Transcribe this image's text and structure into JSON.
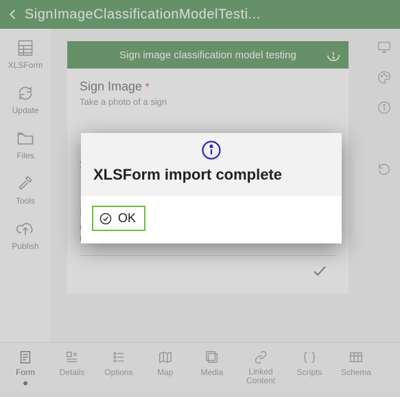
{
  "header": {
    "title": "SignImageClassificationModelTesti..."
  },
  "left_rail": {
    "xlsform": "XLSForm",
    "update": "Update",
    "files": "Files",
    "tools": "Tools",
    "publish": "Publish"
  },
  "form": {
    "title": "Sign image classification model testing",
    "q1_label": "Sign Image",
    "q1_req": "*",
    "q1_hint": "Take a photo of a sign",
    "q2_letter": "S",
    "q3_letter": "I",
    "q3_hint": "Choose yes for the type is what you expect, otherwise choose no"
  },
  "dialog": {
    "title": "XLSForm import complete",
    "ok": "OK"
  },
  "tabs": {
    "form": "Form",
    "details": "Details",
    "options": "Options",
    "map": "Map",
    "media": "Media",
    "linked": "Linked Content",
    "scripts": "Scripts",
    "schema": "Schema"
  }
}
